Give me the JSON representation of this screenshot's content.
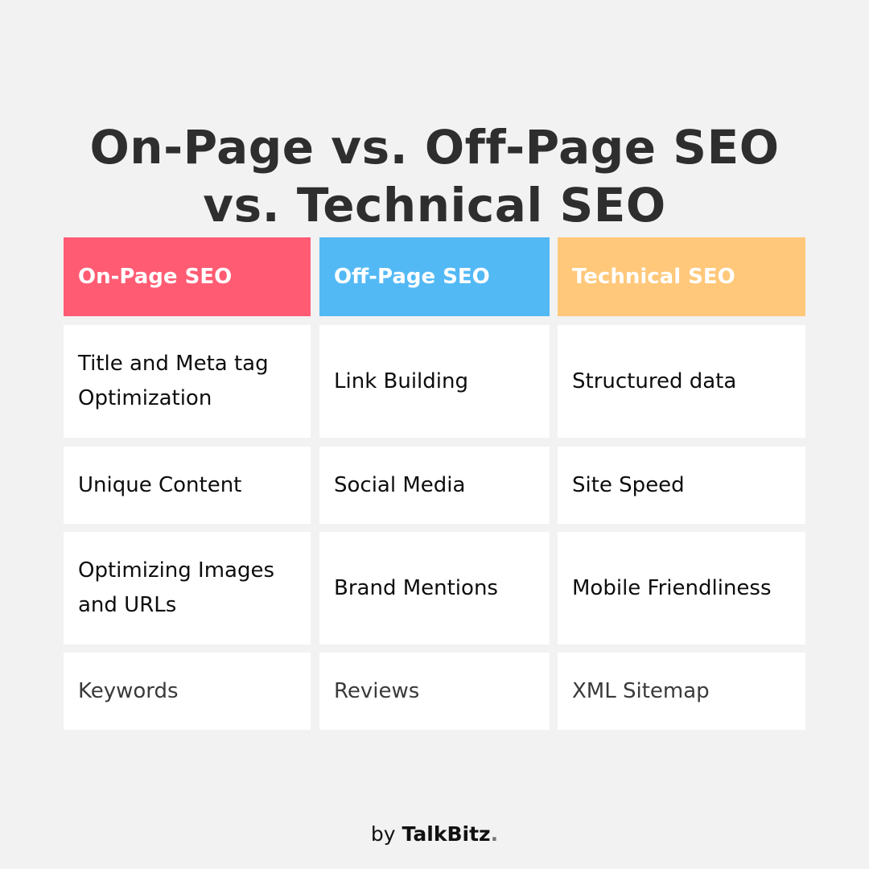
{
  "title": {
    "line1": "On-Page vs. Off-Page SEO",
    "line2": "vs. Technical SEO"
  },
  "table": {
    "columns": [
      {
        "label": "On-Page SEO",
        "color": "#ff5c74"
      },
      {
        "label": "Off-Page SEO",
        "color": "#53b9f5"
      },
      {
        "label": "Technical SEO",
        "color": "#ffc87a"
      }
    ],
    "rows": [
      [
        "Title and Meta tag Optimization",
        "Link Building",
        "Structured data"
      ],
      [
        "Unique Content",
        "Social Media",
        "Site Speed"
      ],
      [
        "Optimizing Images and URLs",
        "Brand Mentions",
        "Mobile Friendliness"
      ],
      [
        "Keywords",
        "Reviews",
        "XML Sitemap"
      ]
    ]
  },
  "footer": {
    "prefix": "by",
    "brand": "TalkBitz",
    "suffix": "."
  }
}
